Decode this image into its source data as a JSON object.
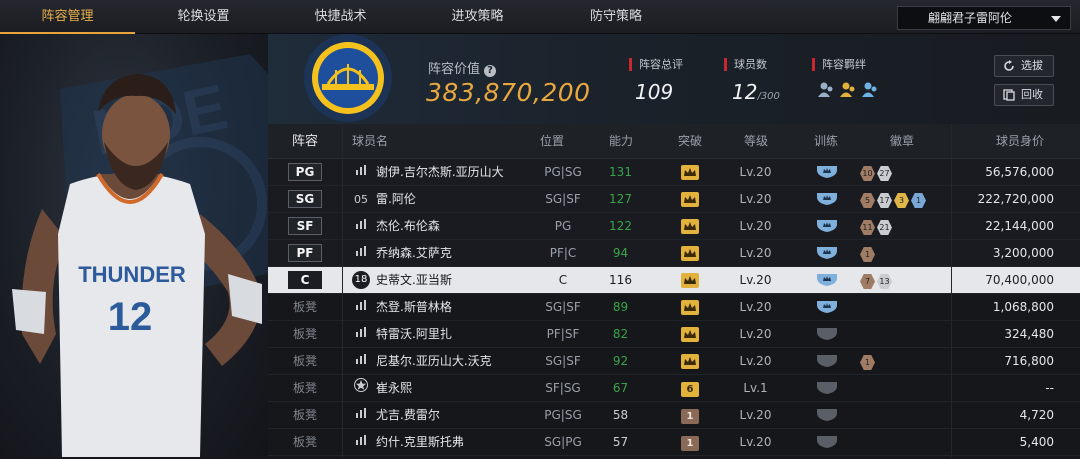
{
  "nav": {
    "tabs": [
      "阵容管理",
      "轮换设置",
      "快捷战术",
      "进攻策略",
      "防守策略"
    ],
    "active_index": 0,
    "team_select": "翩翩君子雷阿伦"
  },
  "summary": {
    "value_label": "阵容价值",
    "value": "383,870,200",
    "rating_label": "阵容总评",
    "rating": "109",
    "count_label": "球员数",
    "count": "12",
    "count_total": "/300",
    "synergy_label": "阵容羁绊",
    "select_button": "选拔",
    "recycle_button": "回收"
  },
  "table": {
    "headers": {
      "lineup": "阵容",
      "name": "球员名",
      "position": "位置",
      "ability": "能力",
      "breakthrough": "突破",
      "level": "等级",
      "training": "训练",
      "badges": "徽章",
      "price": "球员身价"
    },
    "rows": [
      {
        "slot": "PG",
        "icon": "bars",
        "name": "谢伊.吉尔杰斯.亚历山大",
        "position": "PG|SG",
        "ability": "131",
        "ability_color": "#3aa34a",
        "breakthrough": "crown",
        "level": "Lv.20",
        "training": "blue",
        "badges": [
          {
            "tier": "bronze",
            "n": "10"
          },
          {
            "tier": "silver",
            "n": "27"
          }
        ],
        "price": "56,576,000"
      },
      {
        "slot": "SG",
        "icon": "05",
        "name": "雷.阿伦",
        "position": "SG|SF",
        "ability": "127",
        "ability_color": "#3aa34a",
        "breakthrough": "crown",
        "level": "Lv.20",
        "training": "blue",
        "badges": [
          {
            "tier": "bronze",
            "n": "5"
          },
          {
            "tier": "silver",
            "n": "17"
          },
          {
            "tier": "gold",
            "n": "3"
          },
          {
            "tier": "blue",
            "n": "1"
          }
        ],
        "price": "222,720,000"
      },
      {
        "slot": "SF",
        "icon": "bars",
        "name": "杰伦.布伦森",
        "position": "PG",
        "ability": "122",
        "ability_color": "#3aa34a",
        "breakthrough": "crown",
        "level": "Lv.20",
        "training": "blue",
        "badges": [
          {
            "tier": "bronze",
            "n": "11"
          },
          {
            "tier": "silver",
            "n": "21"
          }
        ],
        "price": "22,144,000"
      },
      {
        "slot": "PF",
        "icon": "bars",
        "name": "乔纳森.艾萨克",
        "position": "PF|C",
        "ability": "94",
        "ability_color": "#3aa34a",
        "breakthrough": "crown",
        "level": "Lv.20",
        "training": "blue",
        "badges": [
          {
            "tier": "bronze",
            "n": "1"
          }
        ],
        "price": "3,200,000"
      },
      {
        "slot": "C",
        "icon": "18",
        "name": "史蒂文.亚当斯",
        "position": "C",
        "ability": "116",
        "ability_color": "#1b1d22",
        "breakthrough": "crown",
        "level": "Lv.20",
        "training": "blue",
        "badges": [
          {
            "tier": "bronze",
            "n": "7"
          },
          {
            "tier": "silver",
            "n": "13"
          }
        ],
        "price": "70,400,000",
        "selected": true
      },
      {
        "slot": "板凳",
        "icon": "bars",
        "name": "杰登.斯普林格",
        "position": "SG|SF",
        "ability": "89",
        "ability_color": "#3aa34a",
        "breakthrough": "crown",
        "level": "Lv.20",
        "training": "blue",
        "badges": [],
        "price": "1,068,800"
      },
      {
        "slot": "板凳",
        "icon": "bars",
        "name": "特雷沃.阿里扎",
        "position": "PF|SF",
        "ability": "82",
        "ability_color": "#3aa34a",
        "breakthrough": "crown",
        "level": "Lv.20",
        "training": "gray",
        "badges": [],
        "price": "324,480"
      },
      {
        "slot": "板凳",
        "icon": "bars",
        "name": "尼基尔.亚历山大.沃克",
        "position": "SG|SF",
        "ability": "92",
        "ability_color": "#3aa34a",
        "breakthrough": "crown",
        "level": "Lv.20",
        "training": "gray",
        "badges": [
          {
            "tier": "bronze",
            "n": "1"
          }
        ],
        "price": "716,800"
      },
      {
        "slot": "板凳",
        "icon": "star",
        "name": "崔永熙",
        "position": "SF|SG",
        "ability": "67",
        "ability_color": "#3aa34a",
        "breakthrough": "6",
        "level": "Lv.1",
        "training": "gray",
        "badges": [],
        "price": "--"
      },
      {
        "slot": "板凳",
        "icon": "bars",
        "name": "尤吉.费雷尔",
        "position": "PG|SG",
        "ability": "58",
        "ability_color": "#c9cdd3",
        "breakthrough": "1",
        "level": "Lv.20",
        "training": "gray",
        "badges": [],
        "price": "4,720"
      },
      {
        "slot": "板凳",
        "icon": "bars",
        "name": "约什.克里斯托弗",
        "position": "SG|PG",
        "ability": "57",
        "ability_color": "#c9cdd3",
        "breakthrough": "1",
        "level": "Lv.20",
        "training": "gray",
        "badges": [],
        "price": "5,400"
      }
    ]
  },
  "art": {
    "team_text": "THUNDER",
    "jersey_number": "12"
  }
}
